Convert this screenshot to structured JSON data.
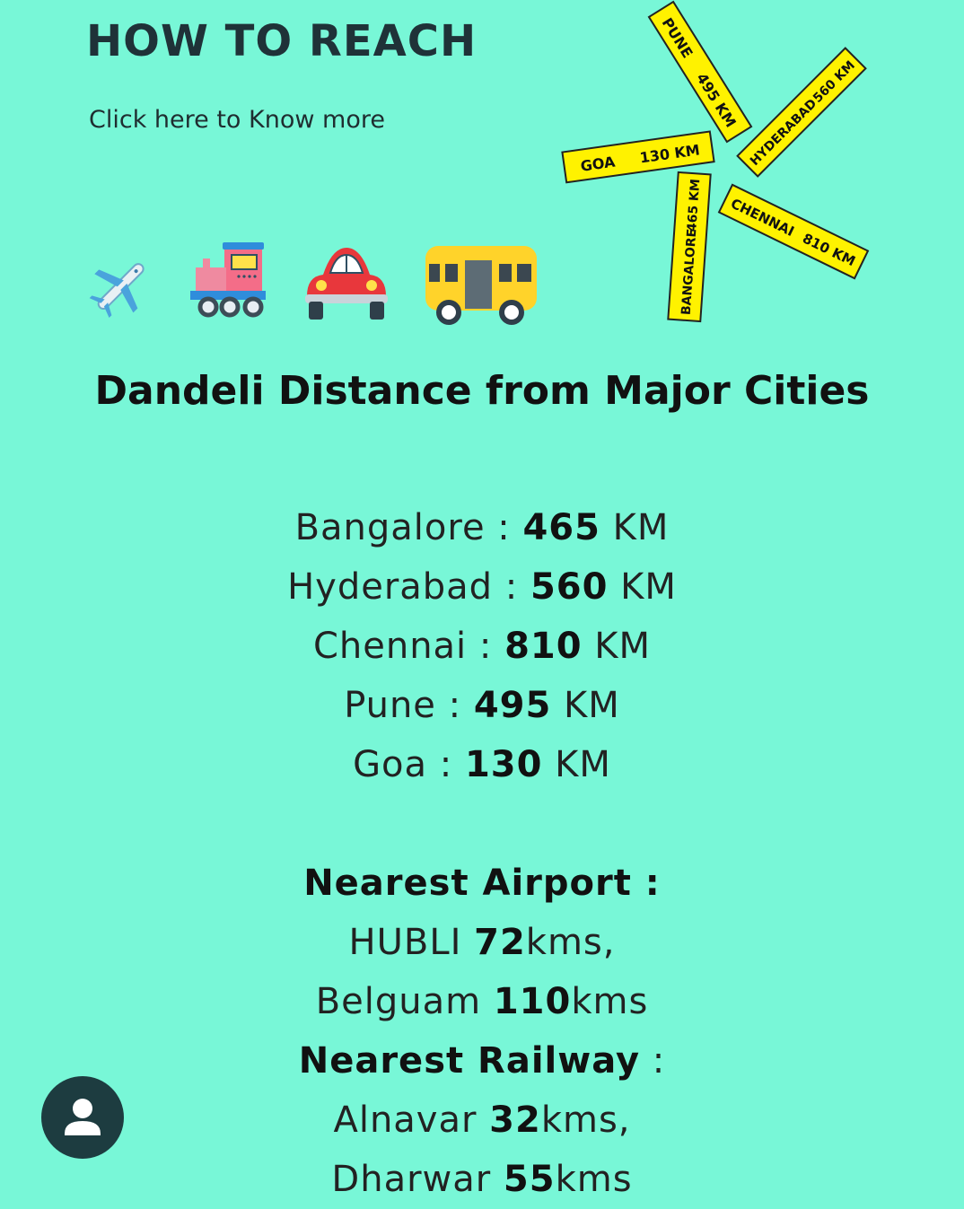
{
  "header": {
    "title": "HOW TO REACH",
    "link_text": "Click here to Know more"
  },
  "transport_icons": [
    "airplane-icon",
    "train-icon",
    "car-icon",
    "bus-icon"
  ],
  "signpost": {
    "signs": [
      {
        "city": "PUNE",
        "distance": "495 KM"
      },
      {
        "city": "GOA",
        "distance": "130 KM"
      },
      {
        "city": "HYDERABAD",
        "distance": "560 KM"
      },
      {
        "city": "BANGALORE",
        "distance": "465 KM"
      },
      {
        "city": "CHENNAI",
        "distance": "810 KM"
      }
    ]
  },
  "section_heading": "Dandeli Distance from Major Cities",
  "distances": [
    {
      "city": "Bangalore",
      "sep": " : ",
      "value": "465",
      "unit": " KM"
    },
    {
      "city": "Hyderabad",
      "sep": " : ",
      "value": "560",
      "unit": " KM"
    },
    {
      "city": "Chennai",
      "sep": " : ",
      "value": "810",
      "unit": " KM"
    },
    {
      "city": "Pune",
      "sep": " : ",
      "value": "495",
      "unit": " KM"
    },
    {
      "city": "Goa",
      "sep": " : ",
      "value": "130",
      "unit": " KM"
    }
  ],
  "nearest_airport": {
    "label": "Nearest Airport :",
    "items": [
      {
        "name": "HUBLI ",
        "value": "72",
        "unit": "kms,"
      },
      {
        "name": "Belguam ",
        "value": "110",
        "unit": "kms"
      }
    ]
  },
  "nearest_railway": {
    "label": "Nearest Railway",
    "suffix": " :",
    "items": [
      {
        "name": "Alnavar ",
        "value": "32",
        "unit": "kms,"
      },
      {
        "name": "Dharwar ",
        "value": "55",
        "unit": "kms"
      }
    ]
  },
  "colors": {
    "background": "#78F7D7",
    "sign_yellow": "#FFF200",
    "avatar_bg": "#1D3C40"
  }
}
